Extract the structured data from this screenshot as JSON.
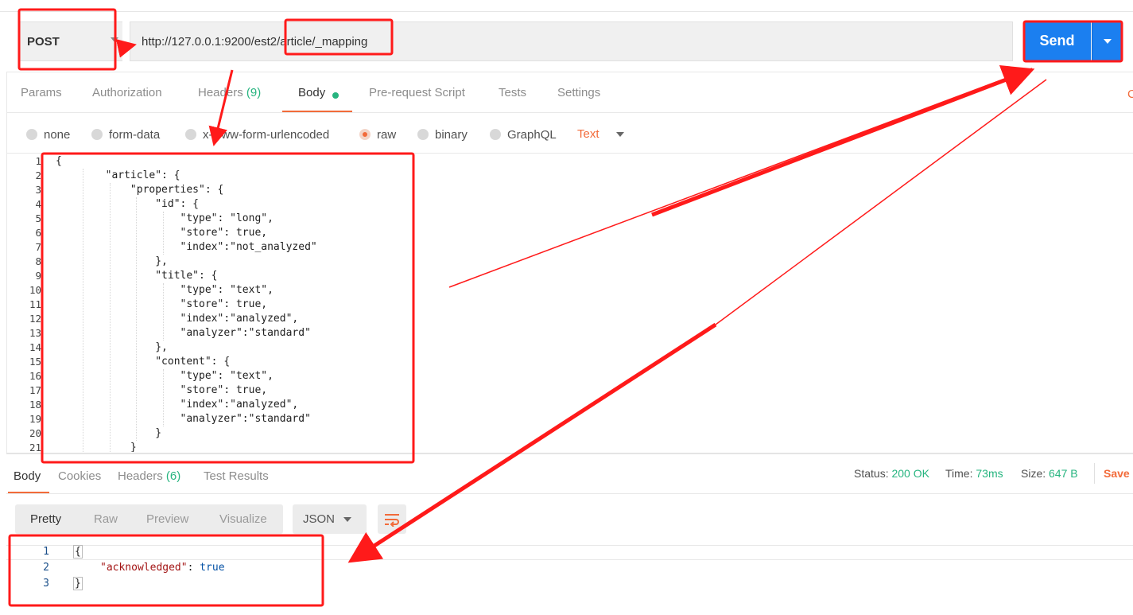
{
  "request": {
    "method": "POST",
    "url": "http://127.0.0.1:9200/est2/article/_mapping",
    "send_label": "Send"
  },
  "request_tabs": {
    "params": "Params",
    "authorization": "Authorization",
    "headers": "Headers",
    "headers_count": "(9)",
    "body": "Body",
    "pre_request": "Pre-request Script",
    "tests": "Tests",
    "settings": "Settings",
    "cookies_clip": "C"
  },
  "body_types": {
    "none": "none",
    "form_data": "form-data",
    "urlencoded": "x-www-form-urlencoded",
    "raw": "raw",
    "binary": "binary",
    "graphql": "GraphQL",
    "text_type": "Text"
  },
  "request_body": {
    "line_numbers": [
      "1",
      "2",
      "3",
      "4",
      "5",
      "6",
      "7",
      "8",
      "9",
      "10",
      "11",
      "12",
      "13",
      "14",
      "15",
      "16",
      "17",
      "18",
      "19",
      "20",
      "21"
    ],
    "lines": [
      "{",
      "        \"article\": {",
      "            \"properties\": {",
      "                \"id\": {",
      "                    \"type\": \"long\",",
      "                    \"store\": true,",
      "                    \"index\":\"not_analyzed\"",
      "                },",
      "                \"title\": {",
      "                    \"type\": \"text\",",
      "                    \"store\": true,",
      "                    \"index\":\"analyzed\",",
      "                    \"analyzer\":\"standard\"",
      "                },",
      "                \"content\": {",
      "                    \"type\": \"text\",",
      "                    \"store\": true,",
      "                    \"index\":\"analyzed\",",
      "                    \"analyzer\":\"standard\"",
      "                }",
      "            }"
    ]
  },
  "response_tabs": {
    "body": "Body",
    "cookies": "Cookies",
    "headers": "Headers",
    "headers_count": "(6)",
    "test_results": "Test Results"
  },
  "response_status": {
    "status_label": "Status:",
    "status_value": "200 OK",
    "time_label": "Time:",
    "time_value": "73ms",
    "size_label": "Size:",
    "size_value": "647 B",
    "save_label": "Save"
  },
  "response_view": {
    "pretty": "Pretty",
    "raw": "Raw",
    "preview": "Preview",
    "visualize": "Visualize",
    "format": "JSON"
  },
  "response_body": {
    "line_numbers": [
      "1",
      "2",
      "3"
    ],
    "open_brace": "{",
    "key": "\"acknowledged\"",
    "colon": ": ",
    "value": "true",
    "close_brace": "}"
  },
  "colors": {
    "accent": "#f26b3a",
    "send_blue": "#1b7ff0",
    "success_green": "#26b47f",
    "annotation_red": "#ff1a1a"
  },
  "icons": [
    "chevron-down-icon",
    "wrap-lines-icon"
  ]
}
